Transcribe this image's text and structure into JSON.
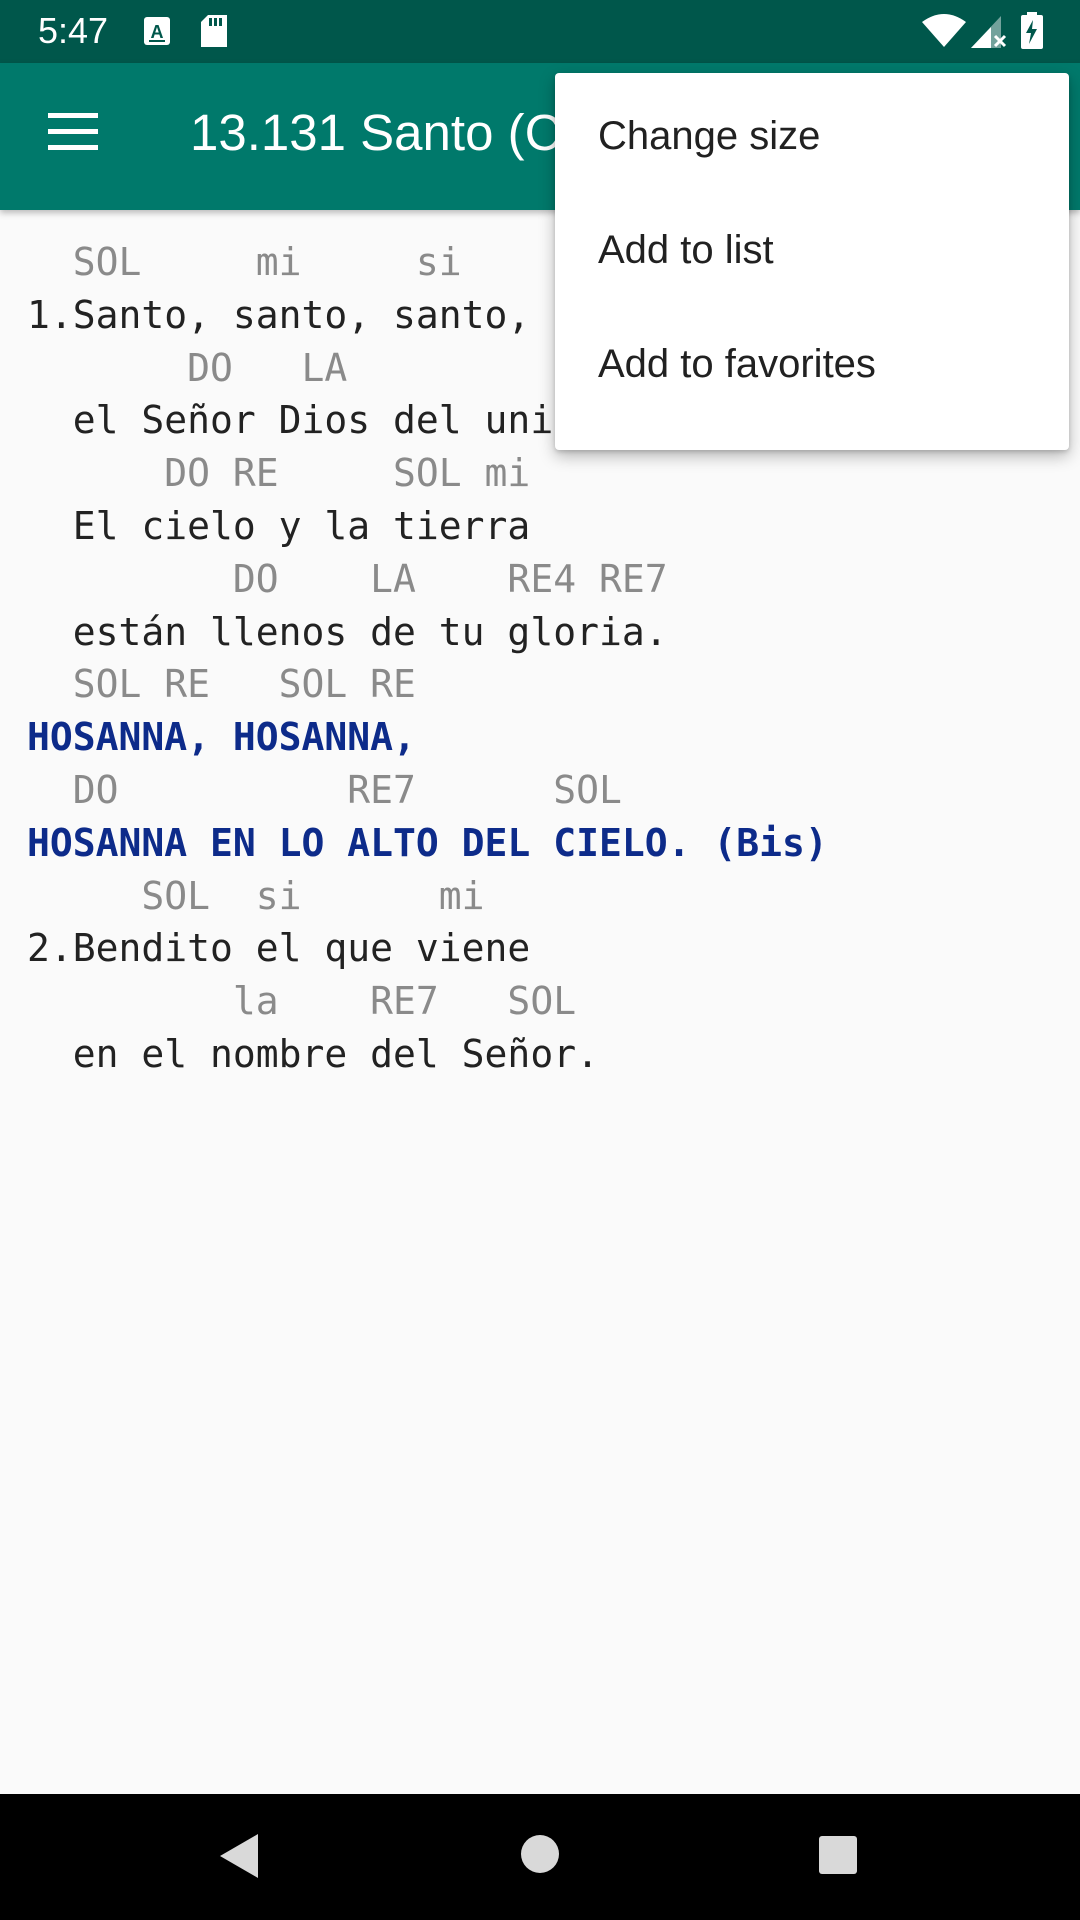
{
  "status_bar": {
    "time": "5:47",
    "icons": [
      "a-notification-icon",
      "sd-card-icon",
      "wifi-icon",
      "signal-icon",
      "battery-charging-icon"
    ],
    "background": "#00574b"
  },
  "app_bar": {
    "title": "13.131 Santo (C",
    "menu_icon": "hamburger-menu-icon",
    "background": "#00796b"
  },
  "overflow_menu": {
    "items": [
      {
        "label": "Change size"
      },
      {
        "label": "Add to list"
      },
      {
        "label": "Add to favorites"
      }
    ]
  },
  "song": {
    "lines": [
      {
        "type": "chord",
        "text": "  SOL     mi     si"
      },
      {
        "type": "lyric",
        "text": "1.Santo, santo, santo,"
      },
      {
        "type": "chord",
        "text": "       DO   LA"
      },
      {
        "type": "lyric",
        "text": "  el Señor Dios del uni"
      },
      {
        "type": "chord",
        "text": "      DO RE     SOL mi"
      },
      {
        "type": "lyric",
        "text": "  El cielo y la tierra"
      },
      {
        "type": "chord",
        "text": "         DO    LA    RE4 RE7"
      },
      {
        "type": "lyric",
        "text": "  están llenos de tu gloria."
      },
      {
        "type": "chord",
        "text": "  SOL RE   SOL RE"
      },
      {
        "type": "chorus",
        "text": "HOSANNA, HOSANNA,"
      },
      {
        "type": "chord",
        "text": "  DO          RE7      SOL"
      },
      {
        "type": "chorus",
        "text": "HOSANNA EN LO ALTO DEL CIELO. (Bis)"
      },
      {
        "type": "chord",
        "text": "     SOL  si      mi"
      },
      {
        "type": "lyric",
        "text": "2.Bendito el que viene"
      },
      {
        "type": "chord",
        "text": "         la    RE7   SOL"
      },
      {
        "type": "lyric",
        "text": "  en el nombre del Señor."
      }
    ],
    "colors": {
      "chord": "#8a8a8a",
      "lyric": "#222222",
      "chorus": "#0d2b8a"
    }
  },
  "nav_bar": {
    "buttons": [
      "back-icon",
      "home-icon",
      "recents-icon"
    ]
  }
}
